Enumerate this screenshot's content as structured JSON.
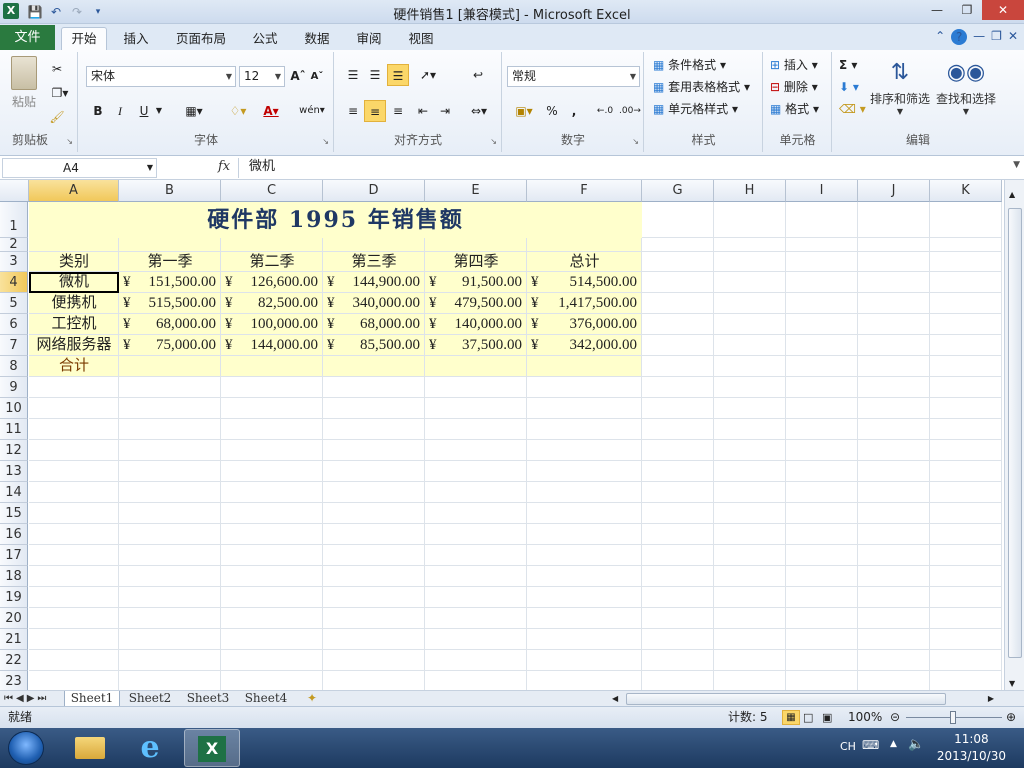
{
  "window": {
    "title": "硬件销售1  [兼容模式]  -  Microsoft Excel",
    "app_icon": "X"
  },
  "ribbon_tabs": [
    "文件",
    "开始",
    "插入",
    "页面布局",
    "公式",
    "数据",
    "审阅",
    "视图"
  ],
  "active_tab": "开始",
  "ribbon": {
    "clipboard": {
      "label": "剪贴板",
      "paste": "粘贴"
    },
    "font": {
      "label": "字体",
      "name": "宋体",
      "size": "12",
      "bold": "B",
      "italic": "I",
      "underline": "U"
    },
    "alignment": {
      "label": "对齐方式"
    },
    "number": {
      "label": "数字",
      "format": "常规",
      "percent": "%",
      "comma": ","
    },
    "styles": {
      "label": "样式",
      "items": [
        "条件格式",
        "套用表格格式",
        "单元格样式"
      ]
    },
    "cells": {
      "label": "单元格",
      "items": [
        "插入",
        "删除",
        "格式"
      ]
    },
    "editing": {
      "label": "编辑",
      "sort": "排序和筛选",
      "find": "查找和选择",
      "sum": "Σ"
    }
  },
  "formula_bar": {
    "name_box": "A4",
    "fx": "fx",
    "content": "微机"
  },
  "columns": [
    "A",
    "B",
    "C",
    "D",
    "E",
    "F",
    "G",
    "H",
    "I",
    "J",
    "K"
  ],
  "rows": [
    "1",
    "2",
    "3",
    "4",
    "5",
    "6",
    "7",
    "8",
    "9",
    "10",
    "11",
    "12",
    "13",
    "14",
    "15",
    "16",
    "17",
    "18",
    "19",
    "20",
    "21",
    "22",
    "23"
  ],
  "sheet": {
    "title": "硬件部  1995  年销售额",
    "headers": [
      "类别",
      "第一季",
      "第二季",
      "第三季",
      "第四季",
      "总计"
    ],
    "currency_symbol": "¥",
    "data_rows": [
      {
        "category": "微机",
        "values": [
          "151,500.00",
          "126,600.00",
          "144,900.00",
          "91,500.00",
          "514,500.00"
        ]
      },
      {
        "category": "便携机",
        "values": [
          "515,500.00",
          "82,500.00",
          "340,000.00",
          "479,500.00",
          "1,417,500.00"
        ]
      },
      {
        "category": "工控机",
        "values": [
          "68,000.00",
          "100,000.00",
          "68,000.00",
          "140,000.00",
          "376,000.00"
        ]
      },
      {
        "category": "网络服务器",
        "values": [
          "75,000.00",
          "144,000.00",
          "85,500.00",
          "37,500.00",
          "342,000.00"
        ]
      }
    ],
    "total_label": "合计",
    "highlight_color": "#ffffcc"
  },
  "sheet_tabs": [
    "Sheet1",
    "Sheet2",
    "Sheet3",
    "Sheet4"
  ],
  "active_sheet": "Sheet1",
  "status_bar": {
    "mode": "就绪",
    "count": "计数: 5",
    "zoom": "100%"
  },
  "taskbar": {
    "lang": "CH",
    "time": "11:08",
    "date": "2013/10/30"
  }
}
